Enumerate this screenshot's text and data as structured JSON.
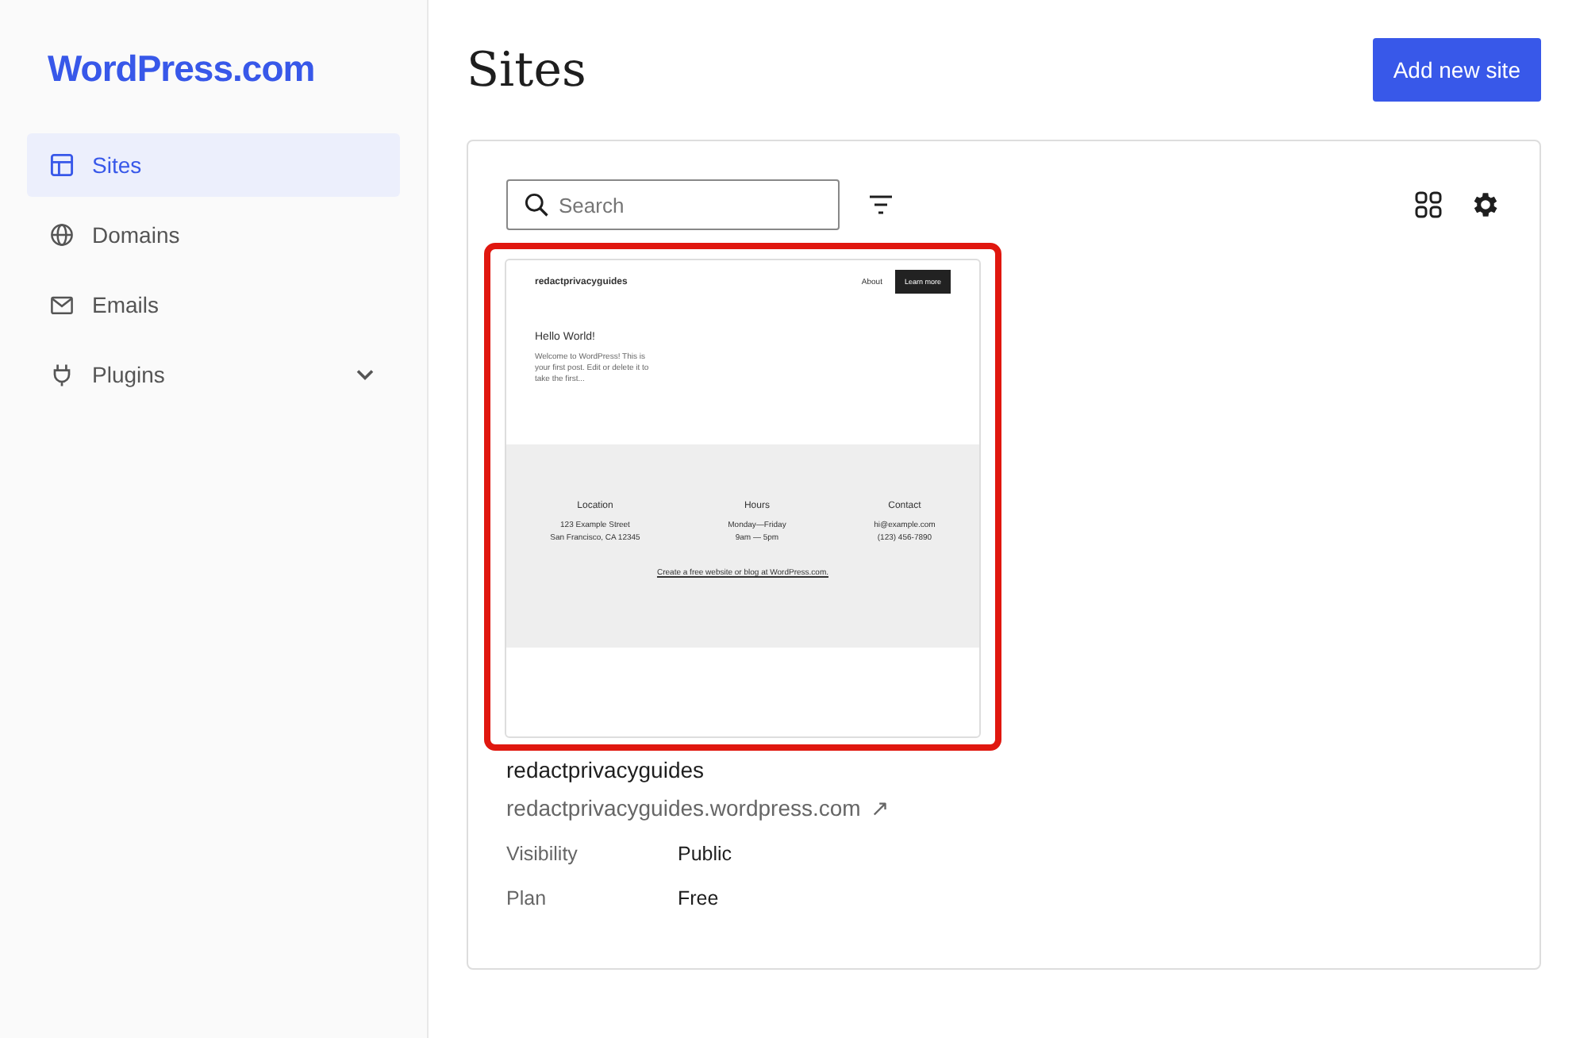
{
  "brand": "WordPress.com",
  "sidebar": {
    "items": [
      {
        "label": "Sites",
        "selected": true,
        "expandable": false
      },
      {
        "label": "Domains",
        "selected": false,
        "expandable": false
      },
      {
        "label": "Emails",
        "selected": false,
        "expandable": false
      },
      {
        "label": "Plugins",
        "selected": false,
        "expandable": true
      }
    ]
  },
  "page_title": "Sites",
  "add_button": "Add new site",
  "search": {
    "placeholder": "Search"
  },
  "site": {
    "preview": {
      "site_name": "redactprivacyguides",
      "nav_link": "About",
      "nav_button": "Learn more",
      "post_title": "Hello World!",
      "post_excerpt": "Welcome to WordPress! This is your first post. Edit or delete it to take the first...",
      "footer_columns": [
        {
          "heading": "Location",
          "lines": [
            "123 Example Street",
            "San Francisco, CA 12345"
          ]
        },
        {
          "heading": "Hours",
          "lines": [
            "Monday—Friday",
            "9am — 5pm"
          ]
        },
        {
          "heading": "Contact",
          "lines": [
            "hi@example.com",
            "(123) 456-7890"
          ]
        }
      ],
      "credit": "Create a free website or blog at WordPress.com."
    },
    "highlighted": true,
    "name": "redactprivacyguides",
    "url": "redactprivacyguides.wordpress.com",
    "url_mark": "↗",
    "details": [
      {
        "label": "Visibility",
        "value": "Public"
      },
      {
        "label": "Plan",
        "value": "Free"
      }
    ]
  }
}
